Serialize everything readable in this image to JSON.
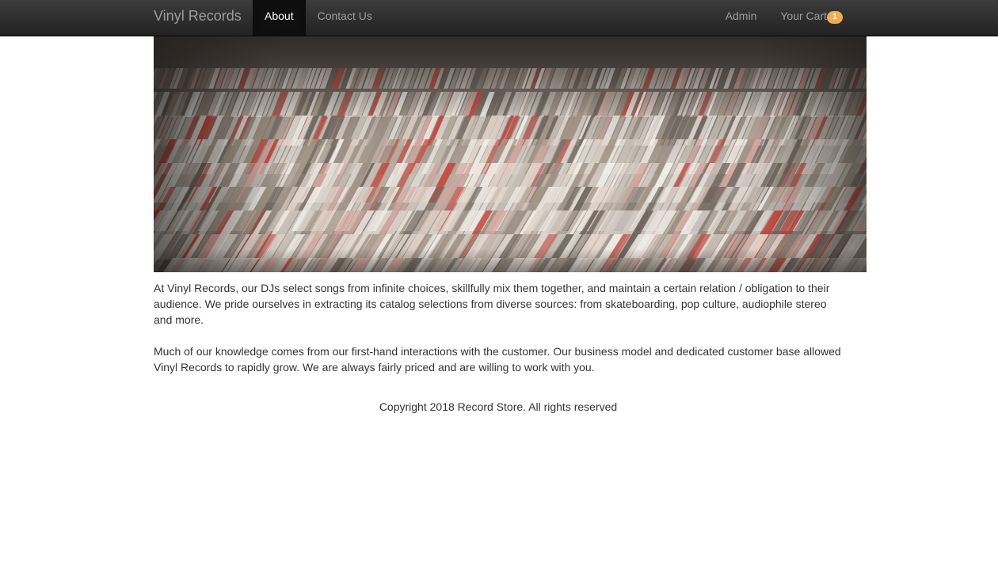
{
  "navbar": {
    "brand": "Vinyl Records",
    "left_items": [
      {
        "label": "About",
        "active": true
      },
      {
        "label": "Contact Us",
        "active": false
      }
    ],
    "right_items": {
      "admin": "Admin",
      "cart_label": "Your Cart",
      "cart_count": "1"
    }
  },
  "hero": {
    "icon": "record-crates-photo"
  },
  "about": {
    "paragraphs": [
      "At Vinyl Records, our DJs select songs from infinite choices, skillfully mix them together, and maintain a certain relation / obligation to their audience. We pride ourselves in extracting its catalog selections from diverse sources: from skateboarding, pop culture, audiophile stereo and more.",
      "Much of our knowledge comes from our first-hand interactions with the customer. Our business model and dedicated customer base allowed Vinyl Records to rapidly grow. We are always fairly priced and are willing to work with you."
    ]
  },
  "footer": {
    "copyright": "Copyright 2018 Record Store. All rights reserved"
  },
  "colors": {
    "navbar_bg": "#222222",
    "nav_text": "#9d9d9d",
    "active_text": "#ffffff",
    "badge": "#f0ad4e"
  }
}
